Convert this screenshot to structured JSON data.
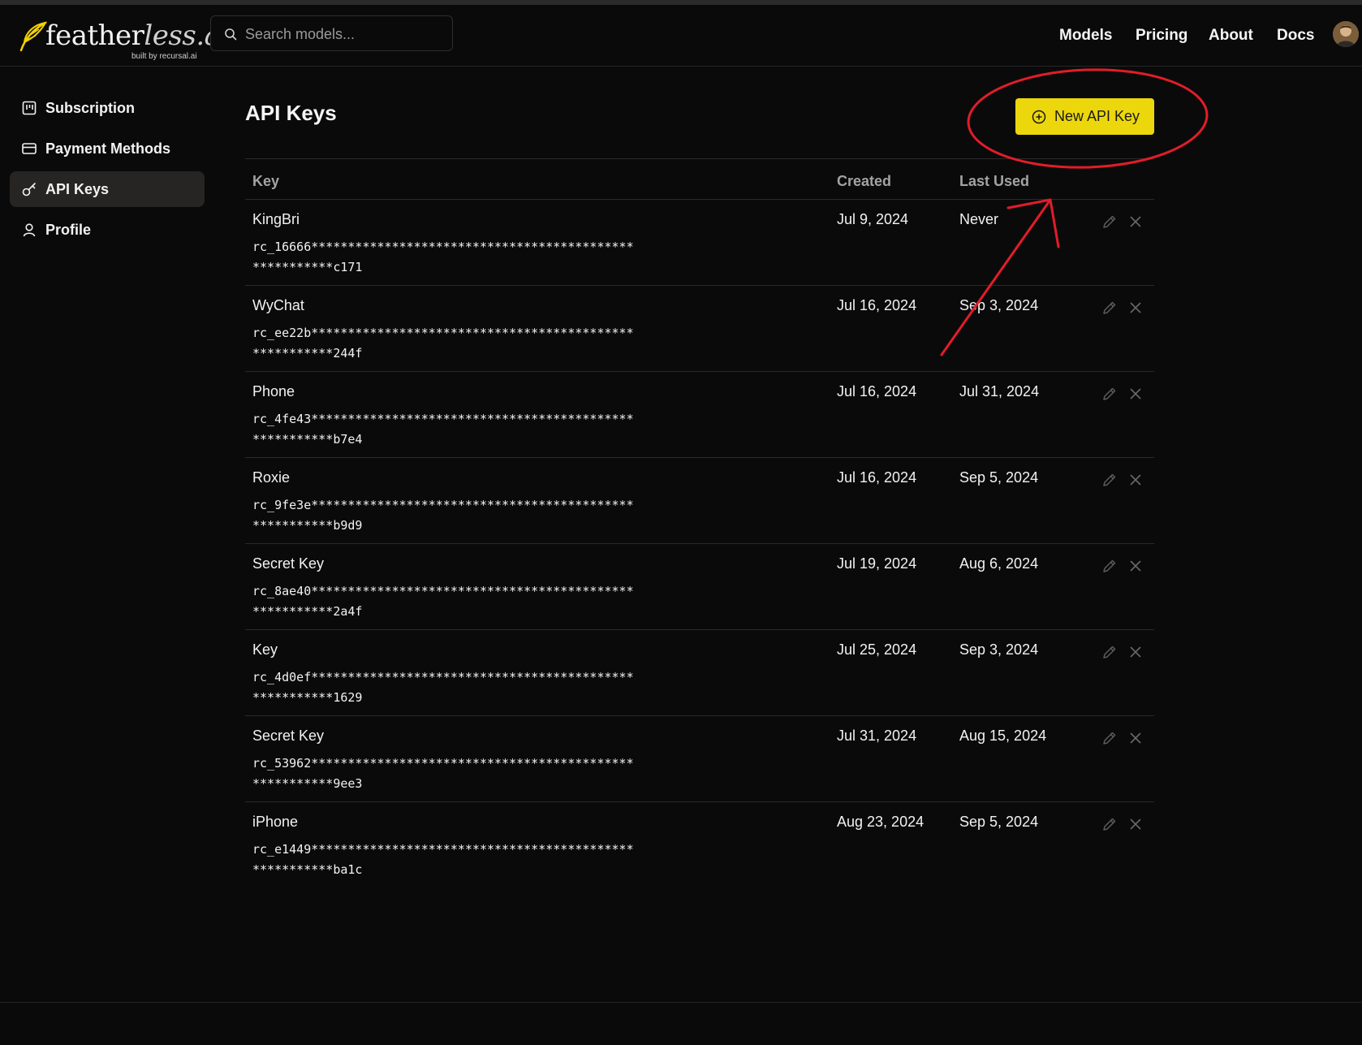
{
  "header": {
    "brand_main": "feather",
    "brand_lite": "less.ai",
    "brand_sub": "built by recursal.ai",
    "search_placeholder": "Search models...",
    "nav": {
      "models": "Models",
      "pricing": "Pricing",
      "about": "About",
      "docs": "Docs"
    }
  },
  "sidebar": {
    "items": [
      {
        "label": "Subscription",
        "icon": "subscription-icon"
      },
      {
        "label": "Payment Methods",
        "icon": "credit-card-icon"
      },
      {
        "label": "API Keys",
        "icon": "key-icon",
        "active": true
      },
      {
        "label": "Profile",
        "icon": "user-icon"
      }
    ]
  },
  "main": {
    "title": "API Keys",
    "new_button_label": "New API Key",
    "columns": {
      "key": "Key",
      "created": "Created",
      "last_used": "Last Used"
    },
    "rows": [
      {
        "name": "KingBri",
        "key": "rc_16666*******************************************************c171",
        "created": "Jul 9, 2024",
        "last_used": "Never"
      },
      {
        "name": "WyChat",
        "key": "rc_ee22b*******************************************************244f",
        "created": "Jul 16, 2024",
        "last_used": "Sep 3, 2024"
      },
      {
        "name": "Phone",
        "key": "rc_4fe43*******************************************************b7e4",
        "created": "Jul 16, 2024",
        "last_used": "Jul 31, 2024"
      },
      {
        "name": "Roxie",
        "key": "rc_9fe3e*******************************************************b9d9",
        "created": "Jul 16, 2024",
        "last_used": "Sep 5, 2024"
      },
      {
        "name": "Secret Key",
        "key": "rc_8ae40*******************************************************2a4f",
        "created": "Jul 19, 2024",
        "last_used": "Aug 6, 2024"
      },
      {
        "name": "Key",
        "key": "rc_4d0ef*******************************************************1629",
        "created": "Jul 25, 2024",
        "last_used": "Sep 3, 2024"
      },
      {
        "name": "Secret Key",
        "key": "rc_53962*******************************************************9ee3",
        "created": "Jul 31, 2024",
        "last_used": "Aug 15, 2024"
      },
      {
        "name": "iPhone",
        "key": "rc_e1449*******************************************************ba1c",
        "created": "Aug 23, 2024",
        "last_used": "Sep 5, 2024"
      }
    ]
  },
  "annotation": {
    "color": "#e11d2a"
  },
  "colors": {
    "background": "#0b0a0a",
    "accent": "#ecd70d",
    "active_item": "#272524",
    "muted_text": "#a3a3a3"
  }
}
